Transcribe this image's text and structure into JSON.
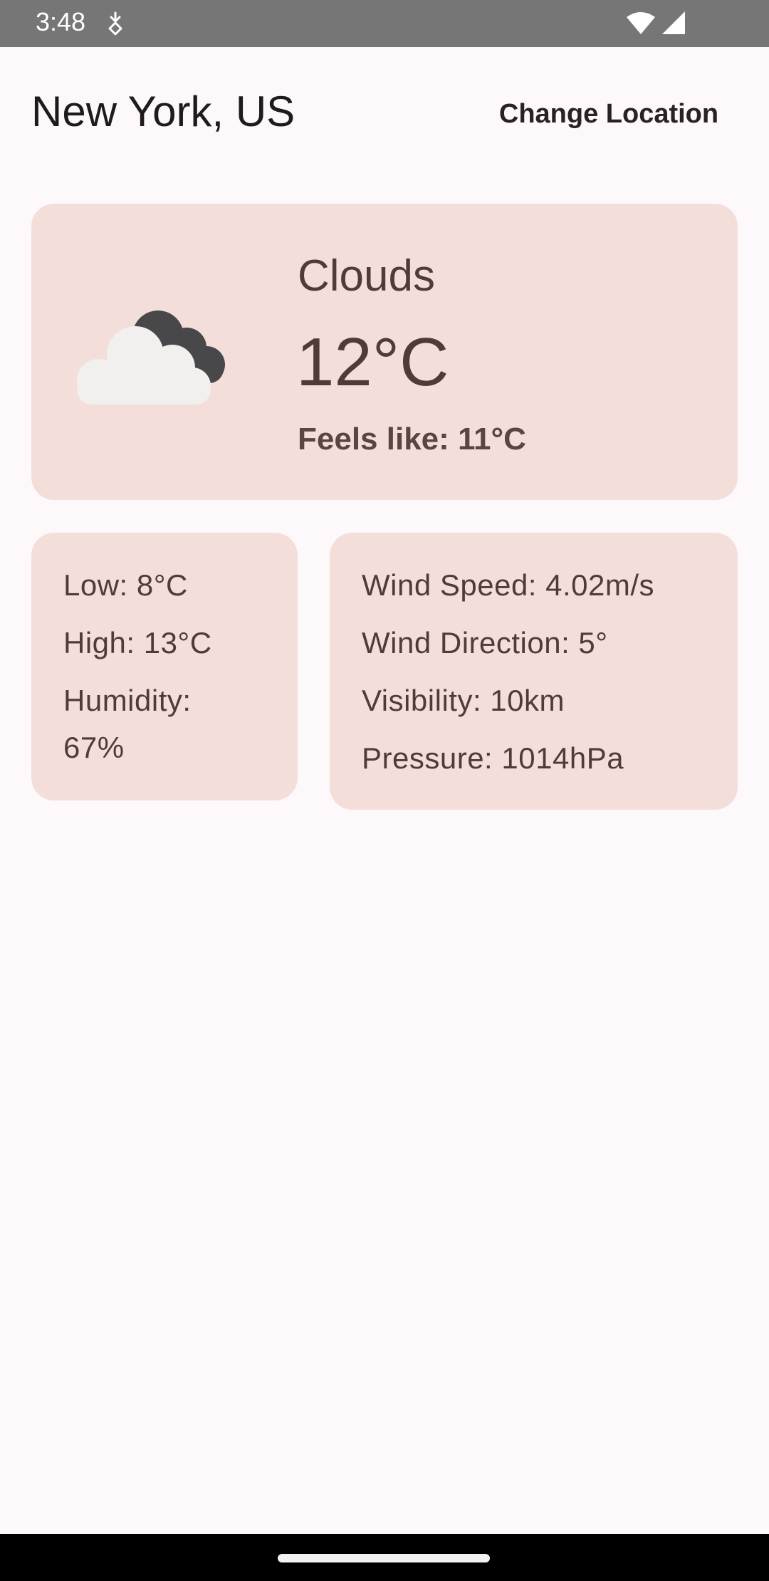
{
  "status_bar": {
    "time": "3:48",
    "icons": [
      "dnd-icon",
      "wifi-icon",
      "cellular-signal-icon"
    ]
  },
  "header": {
    "location": "New York, US",
    "change_location_label": "Change Location"
  },
  "current": {
    "icon": "cloud-icon",
    "condition": "Clouds",
    "temperature": "12°C",
    "feels_like": "Feels like: 11°C"
  },
  "details_left": {
    "low": "Low: 8°C",
    "high": "High: 13°C",
    "humidity_label": "Humidity:",
    "humidity_value": "67%"
  },
  "details_right": {
    "wind_speed": "Wind Speed: 4.02m/s",
    "wind_direction": "Wind Direction: 5°",
    "visibility": "Visibility: 10km",
    "pressure": "Pressure: 1014hPa"
  },
  "colors": {
    "background": "#fdf8fa",
    "card": "#f4ded9",
    "text": "#4f3b38",
    "status_bar": "#767676",
    "nav_bar": "#000000"
  }
}
